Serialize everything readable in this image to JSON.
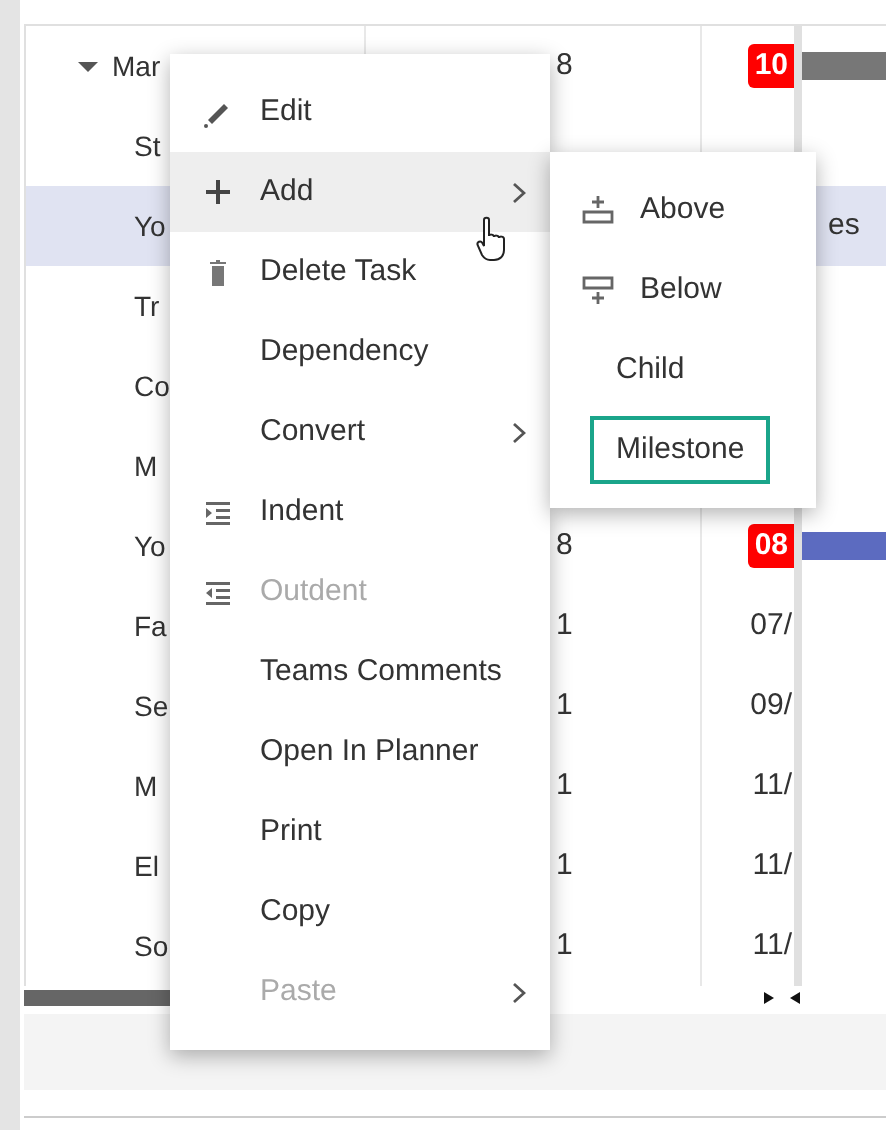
{
  "grid": {
    "rows": [
      {
        "name": "Mar",
        "kind": "summary",
        "selected": false,
        "column_2": "8",
        "column_3": {
          "kind": "badge",
          "text": "10"
        },
        "chart": {
          "kind": "bar",
          "color": "#777777"
        }
      },
      {
        "name": "St",
        "kind": "task",
        "selected": false
      },
      {
        "name": "Yo",
        "kind": "task",
        "selected": true,
        "chart": {
          "kind": "text",
          "text": "es"
        }
      },
      {
        "name": "Tr",
        "kind": "task",
        "selected": false
      },
      {
        "name": "Co",
        "kind": "task",
        "selected": false
      },
      {
        "name": "M",
        "kind": "task",
        "selected": false
      },
      {
        "name": "Yo",
        "kind": "task",
        "selected": false,
        "column_2": "8",
        "column_3": {
          "kind": "badge",
          "text": "08"
        },
        "chart": {
          "kind": "bar",
          "color": "#5c6bc0"
        }
      },
      {
        "name": "Fa",
        "kind": "task",
        "selected": false,
        "column_2": "1",
        "column_3": {
          "kind": "text",
          "text": "07/"
        }
      },
      {
        "name": "Se",
        "kind": "task",
        "selected": false,
        "column_2": "1",
        "column_3": {
          "kind": "text",
          "text": "09/"
        }
      },
      {
        "name": "M",
        "kind": "task",
        "selected": false,
        "column_2": "1",
        "column_3": {
          "kind": "text",
          "text": "11/"
        }
      },
      {
        "name": "El",
        "kind": "task",
        "selected": false,
        "column_2": "1",
        "column_3": {
          "kind": "text",
          "text": "11/"
        }
      },
      {
        "name": "So",
        "kind": "task",
        "selected": false,
        "column_2": "1",
        "column_3": {
          "kind": "text",
          "text": "11/"
        }
      }
    ]
  },
  "context_menu": {
    "items": [
      {
        "label": "Edit",
        "selected": false,
        "disabled": false,
        "submenu": false
      },
      {
        "label": "Add",
        "selected": true,
        "disabled": false,
        "submenu": true
      },
      {
        "label": "Delete Task",
        "selected": false,
        "disabled": false,
        "submenu": false
      },
      {
        "label": "Dependency",
        "selected": false,
        "disabled": false,
        "submenu": false
      },
      {
        "label": "Convert",
        "selected": false,
        "disabled": false,
        "submenu": true
      },
      {
        "label": "Indent",
        "selected": false,
        "disabled": false,
        "submenu": false
      },
      {
        "label": "Outdent",
        "selected": false,
        "disabled": true,
        "submenu": false
      },
      {
        "label": "Teams Comments",
        "selected": false,
        "disabled": false,
        "submenu": false
      },
      {
        "label": "Open In Planner",
        "selected": false,
        "disabled": false,
        "submenu": false
      },
      {
        "label": "Print",
        "selected": false,
        "disabled": false,
        "submenu": false
      },
      {
        "label": "Copy",
        "selected": false,
        "disabled": false,
        "submenu": false
      },
      {
        "label": "Paste",
        "selected": false,
        "disabled": true,
        "submenu": true
      }
    ]
  },
  "submenu": {
    "items": [
      {
        "label": "Above",
        "focused": false
      },
      {
        "label": "Below",
        "focused": false
      },
      {
        "label": "Child",
        "focused": false
      },
      {
        "label": "Milestone",
        "focused": true
      }
    ]
  }
}
